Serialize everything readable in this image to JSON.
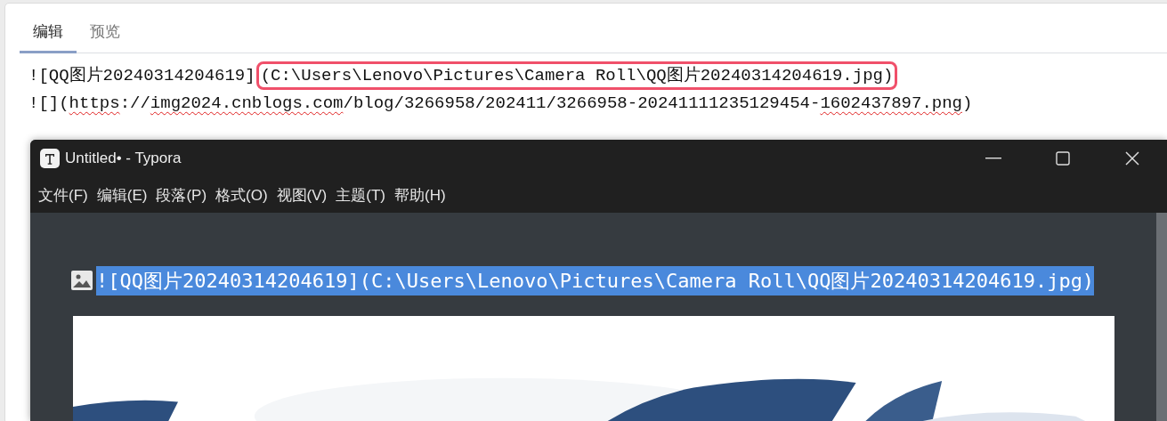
{
  "editor": {
    "tabs": [
      {
        "label": "编辑",
        "selected": true
      },
      {
        "label": "预览",
        "selected": false
      }
    ],
    "lines": [
      {
        "parts": [
          {
            "text": "![QQ图片20240314204619]",
            "highlighted": false,
            "misspelled": false
          },
          {
            "text": "(C:\\Users\\Lenovo\\Pictures\\Camera Roll\\QQ图片20240314204619.jpg)",
            "highlighted": true,
            "misspelled": false
          }
        ]
      },
      {
        "parts": [
          {
            "text": "![](",
            "highlighted": false,
            "misspelled": false
          },
          {
            "text": "https",
            "highlighted": false,
            "misspelled": true
          },
          {
            "text": "://",
            "highlighted": false,
            "misspelled": false
          },
          {
            "text": "img2024.cnblogs.com",
            "highlighted": false,
            "misspelled": true
          },
          {
            "text": "/blog/3266958/202411/3266958-20241111235129454-",
            "highlighted": false,
            "misspelled": false
          },
          {
            "text": "1602437897.png",
            "highlighted": false,
            "misspelled": true
          },
          {
            "text": ")",
            "highlighted": false,
            "misspelled": false
          }
        ]
      }
    ]
  },
  "typora_window": {
    "title": "Untitled• - Typora",
    "menu": [
      "文件(F)",
      "编辑(E)",
      "段落(P)",
      "格式(O)",
      "视图(V)",
      "主题(T)",
      "帮助(H)"
    ],
    "content": {
      "text": "![QQ图片20240314204619](C:\\Users\\Lenovo\\Pictures\\Camera Roll\\QQ图片20240314204619.jpg)",
      "selected": true
    }
  }
}
